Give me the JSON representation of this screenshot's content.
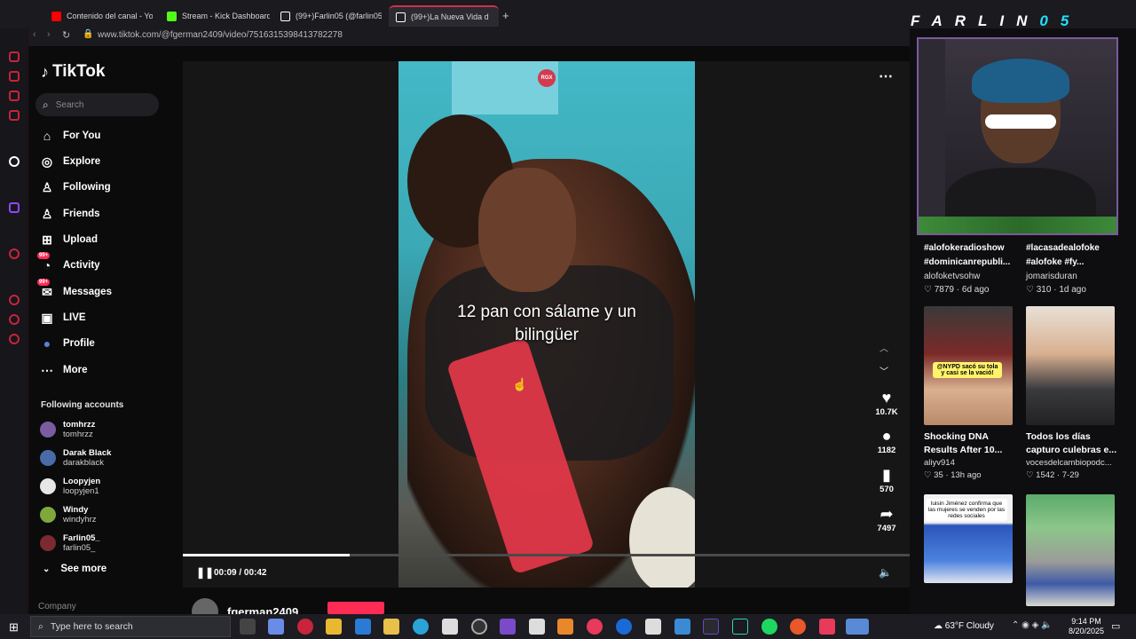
{
  "browser": {
    "tabs": [
      {
        "label": "Contenido del canal - You",
        "favicon_color": "#ff0000"
      },
      {
        "label": "Stream - Kick Dashboard",
        "favicon_color": "#53fc18"
      },
      {
        "label": "(99+)Farlin05 (@farlin05",
        "favicon_color": "#ffffff"
      },
      {
        "label": "(99+)La Nueva Vida d",
        "favicon_color": "#ffffff",
        "active": true
      }
    ],
    "new_tab": "+",
    "url": "www.tiktok.com/@fgerman2409/video/7516315398413782278"
  },
  "sidebar": {
    "logo": "TikTok",
    "search_placeholder": "Search",
    "nav": [
      {
        "label": "For You",
        "icon": "home-icon",
        "glyph": "⌂"
      },
      {
        "label": "Explore",
        "icon": "compass-icon",
        "glyph": "◎"
      },
      {
        "label": "Following",
        "icon": "user-plus-icon",
        "glyph": "♙"
      },
      {
        "label": "Friends",
        "icon": "users-icon",
        "glyph": "♙"
      },
      {
        "label": "Upload",
        "icon": "upload-icon",
        "glyph": "⊞"
      },
      {
        "label": "Activity",
        "icon": "activity-icon",
        "glyph": "◔",
        "badge": "99+"
      },
      {
        "label": "Messages",
        "icon": "messages-icon",
        "glyph": "✉",
        "badge": "99+"
      },
      {
        "label": "LIVE",
        "icon": "live-icon",
        "glyph": "▣"
      },
      {
        "label": "Profile",
        "icon": "profile-avatar-icon",
        "glyph": "●"
      },
      {
        "label": "More",
        "icon": "more-icon",
        "glyph": "⋯"
      }
    ],
    "following_title": "Following accounts",
    "accounts": [
      {
        "name": "tomhrzz",
        "user": "tomhrzz",
        "color": "#7b5c9e"
      },
      {
        "name": "Darak Black",
        "user": "darakblack",
        "color": "#4a6aa8"
      },
      {
        "name": "Loopyjen",
        "user": "loopyjen1",
        "color": "#e6e6e6"
      },
      {
        "name": "Windy",
        "user": "windyhrz",
        "color": "#7fa83c"
      },
      {
        "name": "Farlin05_",
        "user": "farlin05_",
        "color": "#7a2a30"
      }
    ],
    "see_more": "See more",
    "company": "Company"
  },
  "video": {
    "caption": "12 pan con sálame y un bilingüer",
    "watermark": "RGX",
    "time": "00:09 / 00:42",
    "progress": 0.23,
    "likes": "10.7K",
    "comments": "1182",
    "saves": "570",
    "shares": "7497",
    "author": "fgerman2409"
  },
  "right_panel": {
    "brand_letters": [
      "F",
      "A",
      "R",
      "L",
      "I",
      "N"
    ],
    "brand_digits": [
      "0",
      "5"
    ],
    "top_cards": [
      {
        "title_lines": [
          "#alofokeradioshow",
          "#dominicanrepubli..."
        ],
        "user": "alofoketvsohw",
        "likes": "7879",
        "age": "6d ago"
      },
      {
        "title_lines": [
          "#lacasadealofoke",
          "#alofoke #fy..."
        ],
        "user": "jomarisduran",
        "likes": "310",
        "age": "1d ago"
      }
    ],
    "mid_cards": [
      {
        "title_lines": [
          "Shocking DNA",
          "Results After 10..."
        ],
        "user": "aliyv914",
        "likes": "35",
        "age": "13h ago",
        "overlay": "@NYPD sacó su tola y casi se la vació!"
      },
      {
        "title_lines": [
          "Todos los días",
          "capturo culebras e..."
        ],
        "user": "vocesdelcambiopodc...",
        "likes": "1542",
        "age": "7-29"
      }
    ],
    "bottom_overlay": "luisin Jiménez confirma que las mujeres se venden por las redes sociales"
  },
  "taskbar": {
    "search_placeholder": "Type here to search",
    "weather": "63°F  Cloudy",
    "time": "9:14 PM",
    "date": "8/20/2025"
  },
  "colors": {
    "accent": "#fe2c55",
    "opera": "#d0304a",
    "brand_digit": "#21e1ff"
  }
}
